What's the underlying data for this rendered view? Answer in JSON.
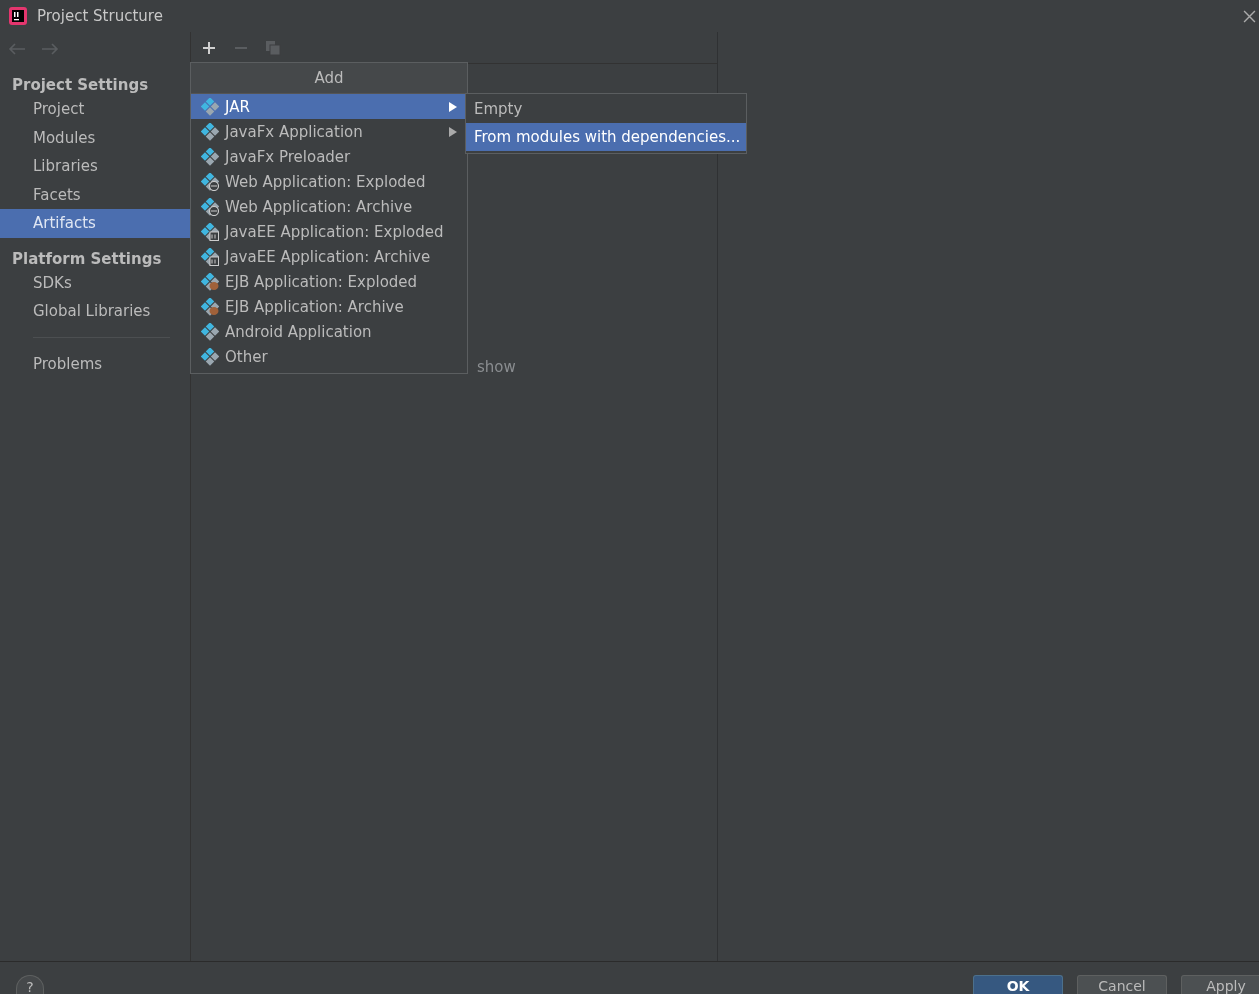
{
  "window": {
    "title": "Project Structure"
  },
  "nav": [
    {
      "kind": "back",
      "disabled": true
    },
    {
      "kind": "forward",
      "disabled": true
    }
  ],
  "sidebar": {
    "items": [
      {
        "kind": "header",
        "label": "Project Settings"
      },
      {
        "kind": "item",
        "label": "Project",
        "selected": false
      },
      {
        "kind": "item",
        "label": "Modules",
        "selected": false
      },
      {
        "kind": "item",
        "label": "Libraries",
        "selected": false
      },
      {
        "kind": "item",
        "label": "Facets",
        "selected": false
      },
      {
        "kind": "item",
        "label": "Artifacts",
        "selected": true
      },
      {
        "kind": "header",
        "label": "Platform Settings"
      },
      {
        "kind": "item",
        "label": "SDKs",
        "selected": false
      },
      {
        "kind": "item",
        "label": "Global Libraries",
        "selected": false
      },
      {
        "kind": "divider"
      },
      {
        "kind": "item",
        "label": "Problems",
        "selected": false
      }
    ]
  },
  "toolbar": [
    {
      "kind": "add",
      "disabled": false
    },
    {
      "kind": "remove",
      "disabled": true
    },
    {
      "kind": "copy",
      "disabled": true
    }
  ],
  "empty_text": "show",
  "popup": {
    "title": "Add",
    "items": [
      {
        "label": "JAR",
        "kind": "plain",
        "submenu": true,
        "selected": true
      },
      {
        "label": "JavaFx Application",
        "kind": "plain",
        "submenu": true,
        "selected": false
      },
      {
        "label": "JavaFx Preloader",
        "kind": "plain",
        "submenu": false,
        "selected": false
      },
      {
        "label": "Web Application: Exploded",
        "kind": "web",
        "submenu": false,
        "selected": false
      },
      {
        "label": "Web Application: Archive",
        "kind": "web",
        "submenu": false,
        "selected": false
      },
      {
        "label": "JavaEE Application: Exploded",
        "kind": "javaee",
        "submenu": false,
        "selected": false
      },
      {
        "label": "JavaEE Application: Archive",
        "kind": "javaee",
        "submenu": false,
        "selected": false
      },
      {
        "label": "EJB Application: Exploded",
        "kind": "ejb",
        "submenu": false,
        "selected": false
      },
      {
        "label": "EJB Application: Archive",
        "kind": "ejb",
        "submenu": false,
        "selected": false
      },
      {
        "label": "Android Application",
        "kind": "plain",
        "submenu": false,
        "selected": false
      },
      {
        "label": "Other",
        "kind": "plain",
        "submenu": false,
        "selected": false
      }
    ]
  },
  "submenu": {
    "items": [
      {
        "label": "Empty",
        "selected": false
      },
      {
        "label": "From modules with dependencies...",
        "selected": true
      }
    ]
  },
  "footer": {
    "help": "?",
    "buttons": [
      {
        "label": "OK",
        "default": true
      },
      {
        "label": "Cancel",
        "default": false
      },
      {
        "label": "Apply",
        "default": false
      }
    ]
  }
}
